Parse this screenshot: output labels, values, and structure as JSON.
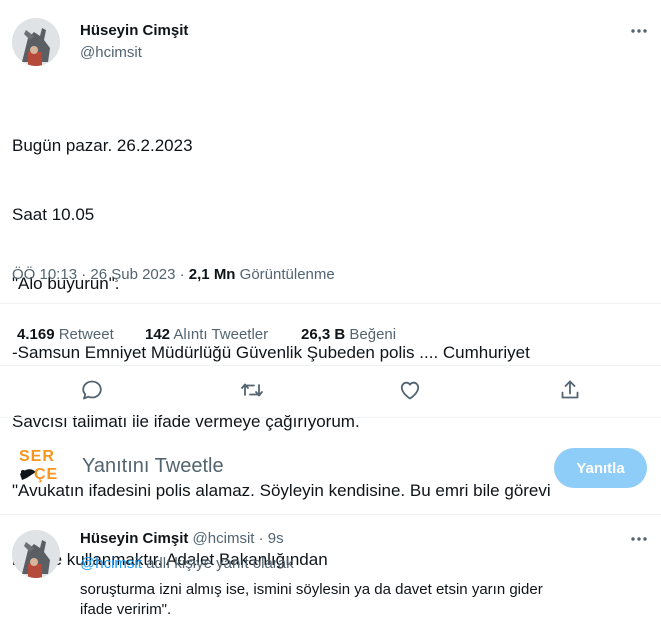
{
  "main_tweet": {
    "display_name": "Hüseyin Cimşit",
    "handle": "@hcimsit",
    "lines": [
      "Bugün pazar. 26.2.2023",
      "Saat 10.05",
      "\"Alo buyurun\".",
      "-Samsun Emniyet Müdürlüğü Güvenlik Şubeden polis .... Cumhuriyet",
      "Savcısı talimatı ile ifade vermeye çağırıyorum.",
      "\"Avukatın ifadesini polis alamaz. Söyleyin kendisine. Bu emri bile görevi",
      "kötüye kullanmaktır. Adalet Bakanlığından"
    ],
    "timestamp": "ÖÖ 10:13 · 26 Şub 2023",
    "separator": "·",
    "views_count": "2,1 Mn",
    "views_label": "Görüntülenme"
  },
  "stats": {
    "retweets_count": "4.169",
    "retweets_label": "Retweet",
    "quotes_count": "142",
    "quotes_label": "Alıntı Tweetler",
    "likes_count": "26,3 B",
    "likes_label": "Beğeni"
  },
  "composer": {
    "logo_top": "SER",
    "logo_bottom": "ÇE",
    "placeholder": "Yanıtını Tweetle",
    "reply_button": "Yanıtla"
  },
  "reply_tweet": {
    "display_name": "Hüseyin Cimşit",
    "handle": "@hcimsit",
    "dot": "·",
    "time": "9s",
    "replying_mention": "@hcimsit",
    "replying_suffix": " adlı kişiye yanıt olarak",
    "lines": [
      "soruşturma izni almış ise, ismini söylesin ya da davet etsin yarın gider",
      "ifade veririm\"."
    ]
  },
  "colors": {
    "accent": "#1d9bf0",
    "muted": "#536471",
    "reply_button_bg": "#8ecdf8",
    "logo_orange": "#f7941d"
  },
  "icons": [
    "more-icon",
    "reply-icon",
    "retweet-icon",
    "like-icon",
    "share-icon",
    "serce-bird-icon"
  ]
}
